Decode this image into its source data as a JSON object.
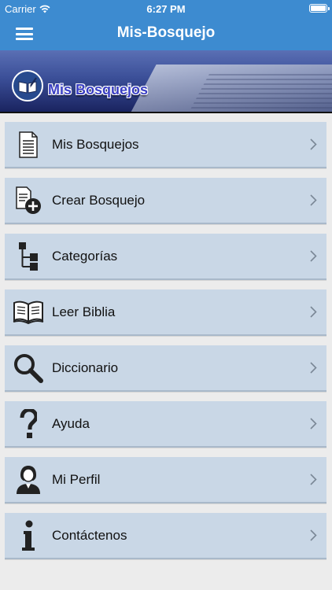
{
  "status_bar": {
    "carrier": "Carrier",
    "time": "6:27 PM"
  },
  "nav": {
    "title": "Mis-Bosquejo",
    "menu_icon": "hamburger-icon"
  },
  "banner": {
    "title": "Mis Bosquejos"
  },
  "menu": {
    "items": [
      {
        "label": "Mis Bosquejos",
        "icon": "document-icon"
      },
      {
        "label": "Crear Bosquejo",
        "icon": "document-add-icon"
      },
      {
        "label": "Categorías",
        "icon": "tree-icon"
      },
      {
        "label": "Leer Biblia",
        "icon": "open-book-icon"
      },
      {
        "label": "Diccionario",
        "icon": "magnifier-icon"
      },
      {
        "label": "Ayuda",
        "icon": "question-icon"
      },
      {
        "label": "Mi Perfil",
        "icon": "person-icon"
      },
      {
        "label": "Contáctenos",
        "icon": "info-icon"
      }
    ]
  },
  "colors": {
    "bar": "#3d8bd0",
    "item_bg": "#c9d7e6",
    "page_bg": "#ececec"
  }
}
